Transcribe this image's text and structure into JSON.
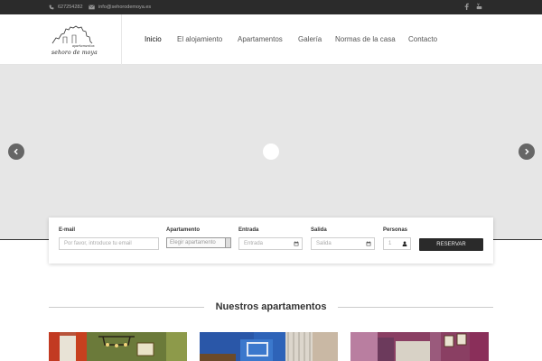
{
  "topbar": {
    "phone": "627254282",
    "email": "info@sehorodemoya.es",
    "phone_icon": "phone-icon",
    "email_icon": "envelope-icon",
    "social": [
      "facebook-icon",
      "youtube-icon"
    ]
  },
  "logo": {
    "subtitle": "apartamentos",
    "name": "sehoro de moya"
  },
  "nav": {
    "items": [
      "Inicio",
      "El alojamiento",
      "Apartamentos",
      "Galería",
      "Normas de la casa",
      "Contacto"
    ],
    "active": "Inicio"
  },
  "hero": {
    "prev_icon": "chevron-left-icon",
    "next_icon": "chevron-right-icon"
  },
  "booking": {
    "email_label": "E-mail",
    "email_placeholder": "Por favor, introduce tu email",
    "apartment_label": "Apartamento",
    "apartment_value": "Elegir apartamento",
    "checkin_label": "Entrada",
    "checkin_placeholder": "Entrada",
    "checkout_label": "Salida",
    "checkout_placeholder": "Salida",
    "guests_label": "Personas",
    "guests_value": "1",
    "submit_label": "RESERVAR"
  },
  "section": {
    "title": "Nuestros apartamentos"
  },
  "colors": {
    "topbar_bg": "#2b2b2b",
    "hero_bg": "#e6e6e6",
    "button_bg": "#2a2a2a"
  }
}
